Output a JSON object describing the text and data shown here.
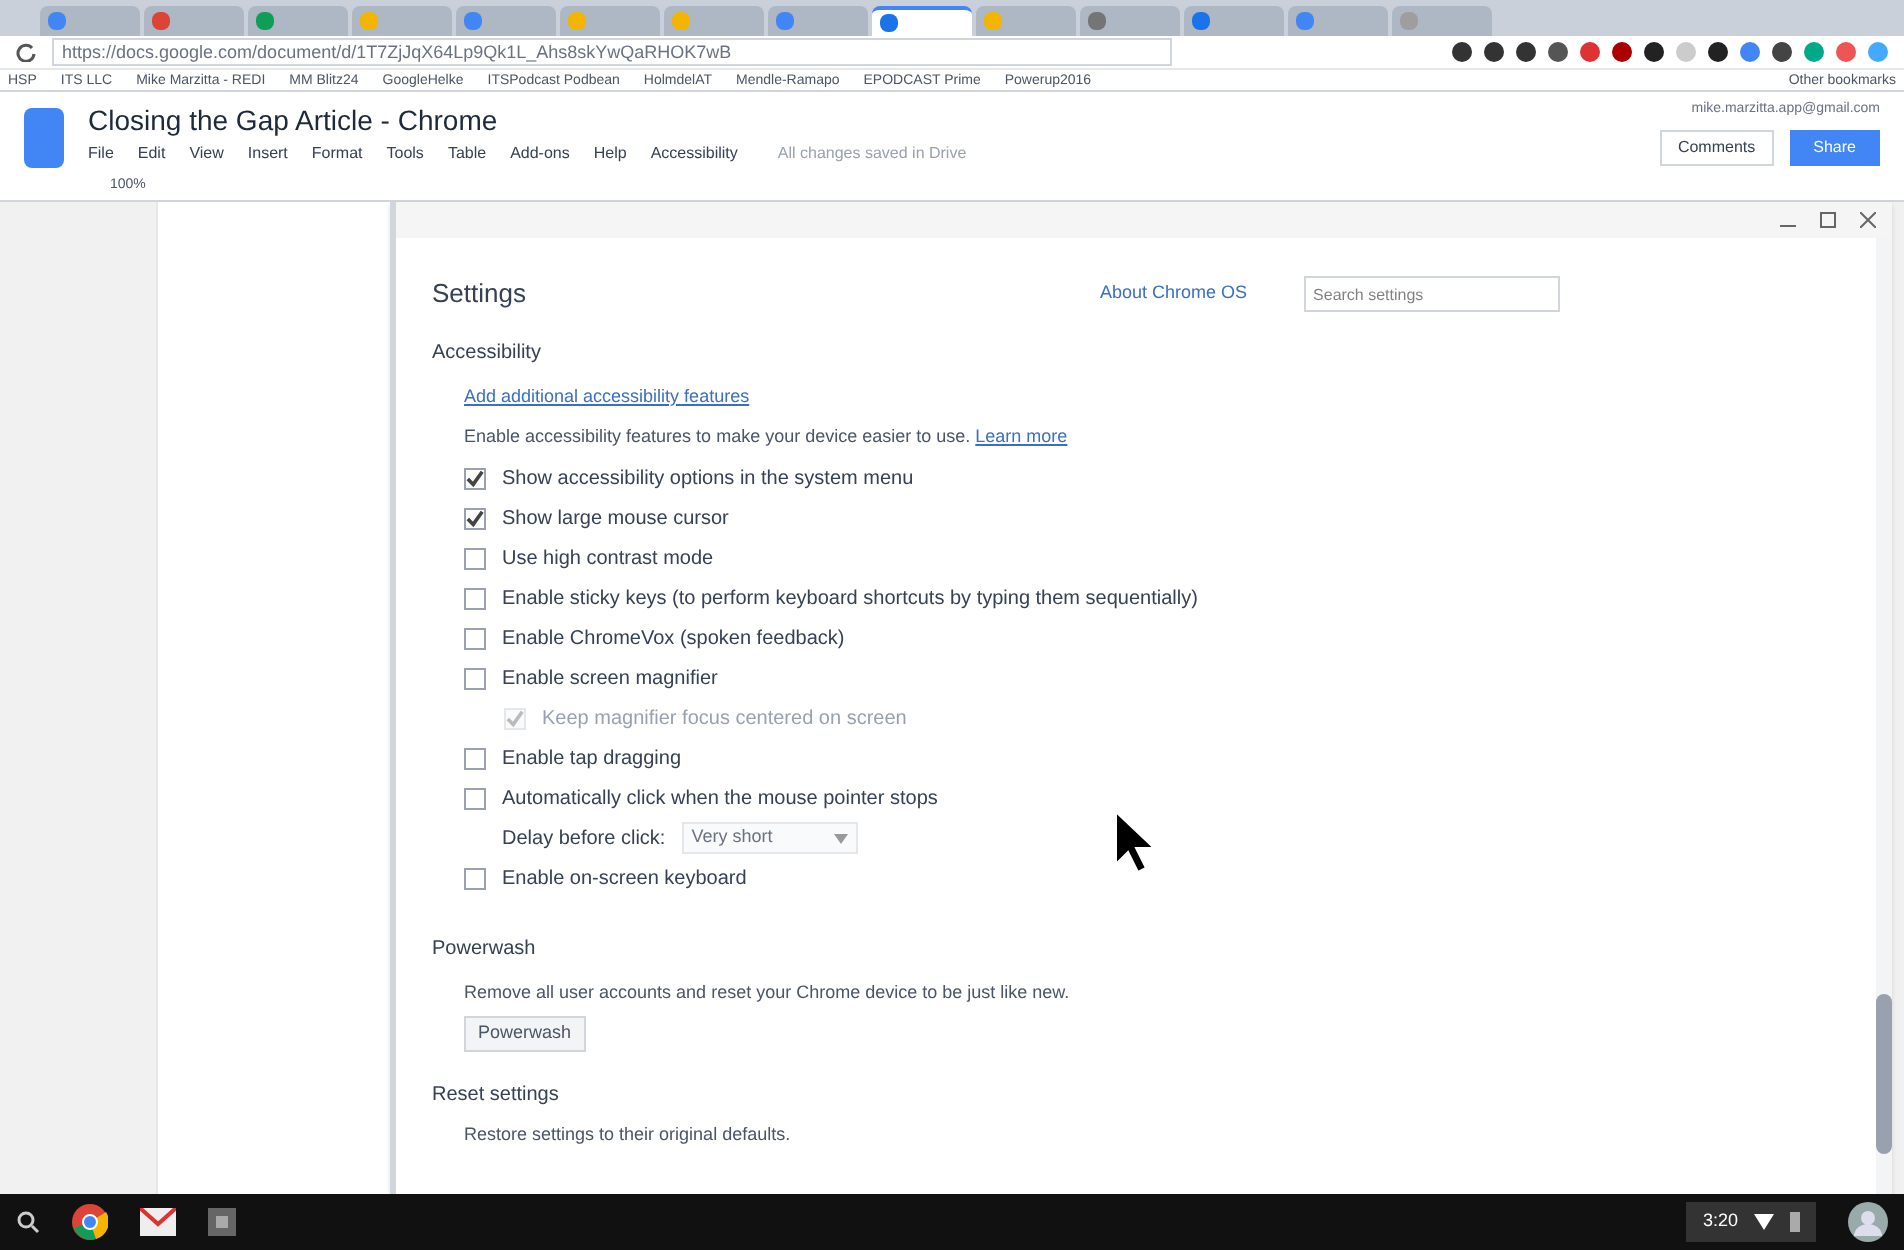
{
  "browser": {
    "tabs": [
      {
        "selected": false
      },
      {
        "selected": false
      },
      {
        "selected": false
      },
      {
        "selected": false
      },
      {
        "selected": false
      },
      {
        "selected": false
      },
      {
        "selected": false
      },
      {
        "selected": false
      },
      {
        "selected": true
      },
      {
        "selected": false
      },
      {
        "selected": false
      },
      {
        "selected": false
      },
      {
        "selected": false
      },
      {
        "selected": false
      }
    ],
    "address": "https://docs.google.com/document/d/1T7ZjJqX64Lp9Qk1L_Ahs8skYwQaRHOK7wB",
    "bookmarks": [
      "HSP",
      "ITS LLC",
      "Mike Marzitta - REDI",
      "MM Blitz24",
      "GoogleHelke",
      "ITSPodcast Podbean",
      "HolmdelAT",
      "Mendle-Ramapo",
      "EPODCAST Prime",
      "Powerup2016"
    ],
    "other_bookmarks": "Other bookmarks"
  },
  "document": {
    "title": "Closing the Gap Article - Chrome",
    "menu": [
      "File",
      "Edit",
      "View",
      "Insert",
      "Format",
      "Tools",
      "Table",
      "Add-ons",
      "Help",
      "Accessibility"
    ],
    "save_status": "All changes saved in Drive",
    "account": "mike.marzitta.app@gmail.com",
    "comments": "Comments",
    "share": "Share",
    "zoom": "100%"
  },
  "settings": {
    "title": "Settings",
    "about_link": "About Chrome OS",
    "search": {
      "placeholder": "Search settings"
    },
    "accessibility": {
      "heading": "Accessibility",
      "add_link": "Add additional accessibility features",
      "description": "Enable accessibility features to make your device easier to use.",
      "learn_more": "Learn more",
      "options": [
        {
          "kind": "checkbox",
          "label": "Show accessibility options in the system menu",
          "checked": true,
          "disabled": false
        },
        {
          "kind": "checkbox",
          "label": "Show large mouse cursor",
          "checked": true,
          "disabled": false
        },
        {
          "kind": "checkbox",
          "label": "Use high contrast mode",
          "checked": false,
          "disabled": false
        },
        {
          "kind": "checkbox",
          "label": "Enable sticky keys (to perform keyboard shortcuts by typing them sequentially)",
          "checked": false,
          "disabled": false
        },
        {
          "kind": "checkbox",
          "label": "Enable ChromeVox (spoken feedback)",
          "checked": false,
          "disabled": false
        },
        {
          "kind": "checkbox",
          "label": "Enable screen magnifier",
          "checked": false,
          "disabled": false,
          "children": [
            {
              "kind": "checkbox",
              "label": "Keep magnifier focus centered on screen",
              "checked": true,
              "disabled": true
            }
          ]
        },
        {
          "kind": "checkbox",
          "label": "Enable tap dragging",
          "checked": false,
          "disabled": false
        },
        {
          "kind": "checkbox",
          "label": "Automatically click when the mouse pointer stops",
          "checked": false,
          "disabled": false
        },
        {
          "kind": "select",
          "label": "Delay before click:",
          "value": "Very short",
          "disabled": true
        },
        {
          "kind": "checkbox",
          "label": "Enable on-screen keyboard",
          "checked": false,
          "disabled": false
        }
      ]
    },
    "powerwash": {
      "heading": "Powerwash",
      "description": "Remove all user accounts and reset your Chrome device to be just like new.",
      "button": "Powerwash"
    },
    "reset": {
      "heading": "Reset settings",
      "description": "Restore settings to their original defaults."
    }
  },
  "shelf": {
    "time": "3:20"
  }
}
